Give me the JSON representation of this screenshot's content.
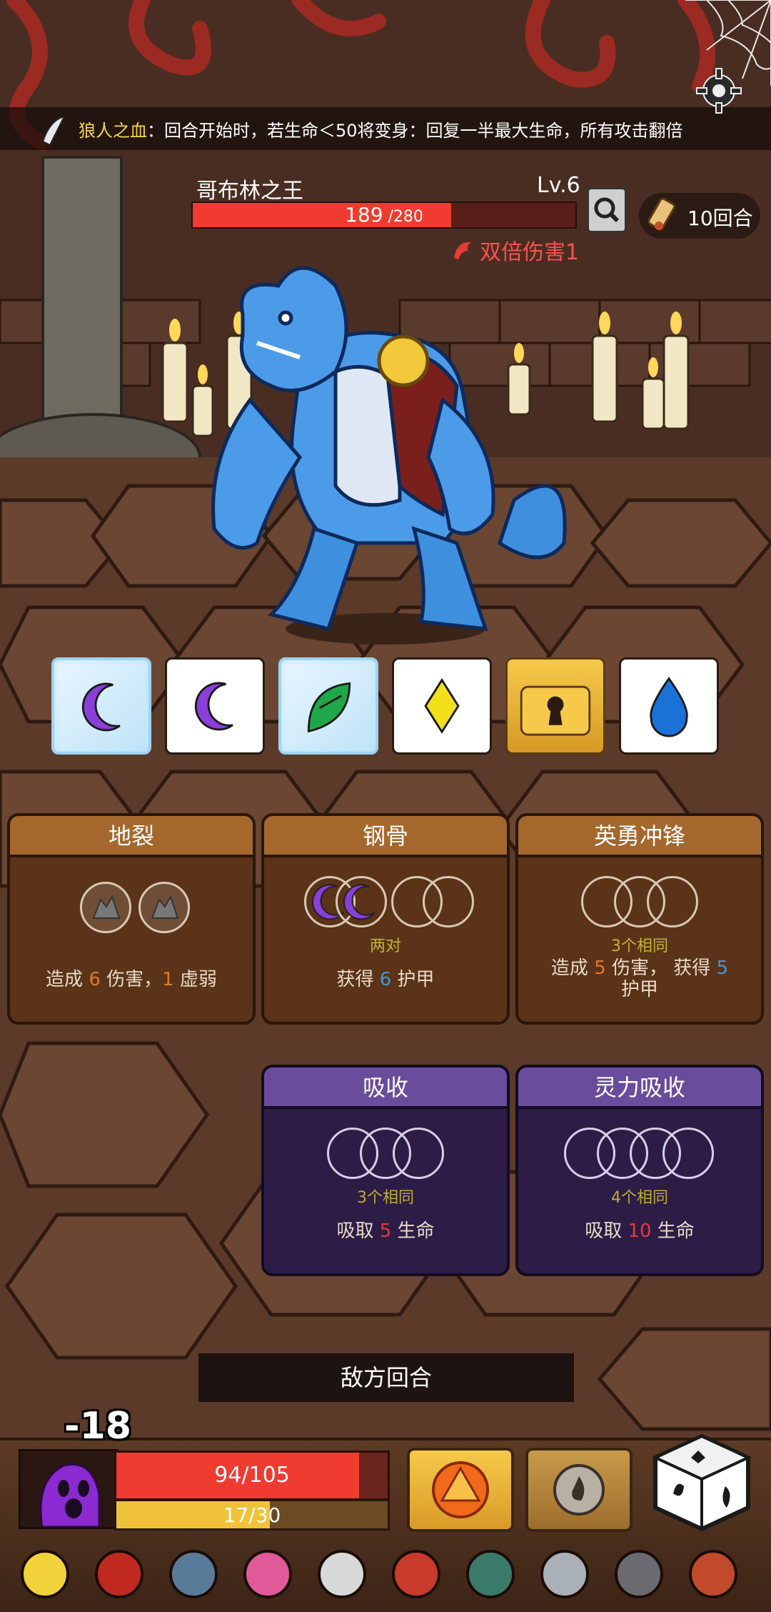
{
  "passive": {
    "name": "狼人之血",
    "description": "：回合开始时，若生命＜50将变身：回复一半最大生命，所有攻击翻倍"
  },
  "enemy": {
    "name": "哥布林之王",
    "level": "Lv.6",
    "hp_current": "189",
    "hp_max": " /280",
    "hp_fraction": 0.675,
    "status": "双倍伤害1"
  },
  "round": {
    "label": "10回合"
  },
  "dice": [
    {
      "face": "moon",
      "color": "#8a3fd8",
      "state": "frozen"
    },
    {
      "face": "moon",
      "color": "#8a3fd8",
      "state": "normal"
    },
    {
      "face": "leaf",
      "color": "#1fa84a",
      "state": "frozen"
    },
    {
      "face": "diamond",
      "color": "#f2e01a",
      "state": "normal"
    },
    {
      "face": "lock",
      "color": "#2a1a12",
      "state": "locked"
    },
    {
      "face": "drop",
      "color": "#1a72d8",
      "state": "normal"
    }
  ],
  "cards": {
    "c1": {
      "title": "地裂",
      "effect_a": "造成 ",
      "num_a": "6",
      "effect_b": " 伤害，",
      "num_b": "1",
      "effect_c": " 虚弱"
    },
    "c2": {
      "title": "钢骨",
      "req": "两对",
      "effect_a": "获得 ",
      "num_a": "6",
      "effect_b": " 护甲"
    },
    "c3": {
      "title": "英勇冲锋",
      "req": "3个相同",
      "effect_a": "造成 ",
      "num_a": "5",
      "effect_b": " 伤害， 获得 ",
      "num_b": "5",
      "effect_c": "护甲"
    },
    "c4": {
      "title": "吸收",
      "req": "3个相同",
      "effect_a": "吸取 ",
      "num_a": "5",
      "effect_b": " 生命"
    },
    "c5": {
      "title": "灵力吸收",
      "req": "4个相同",
      "effect_a": "吸取 ",
      "num_a": "10",
      "effect_b": " 生命"
    }
  },
  "turn_banner": "敌方回合",
  "player": {
    "damage_float": "-18",
    "hp_text": "94/105",
    "hp_fraction": 0.895,
    "mp_text": "17/30",
    "mp_fraction": 0.567
  },
  "items": [
    "cheese-icon",
    "hood-icon",
    "axe-icon",
    "heart-amulet-icon",
    "d20-icon",
    "mask-icon",
    "orb-icon",
    "crown-icon",
    "armor-icon",
    "meat-icon"
  ]
}
